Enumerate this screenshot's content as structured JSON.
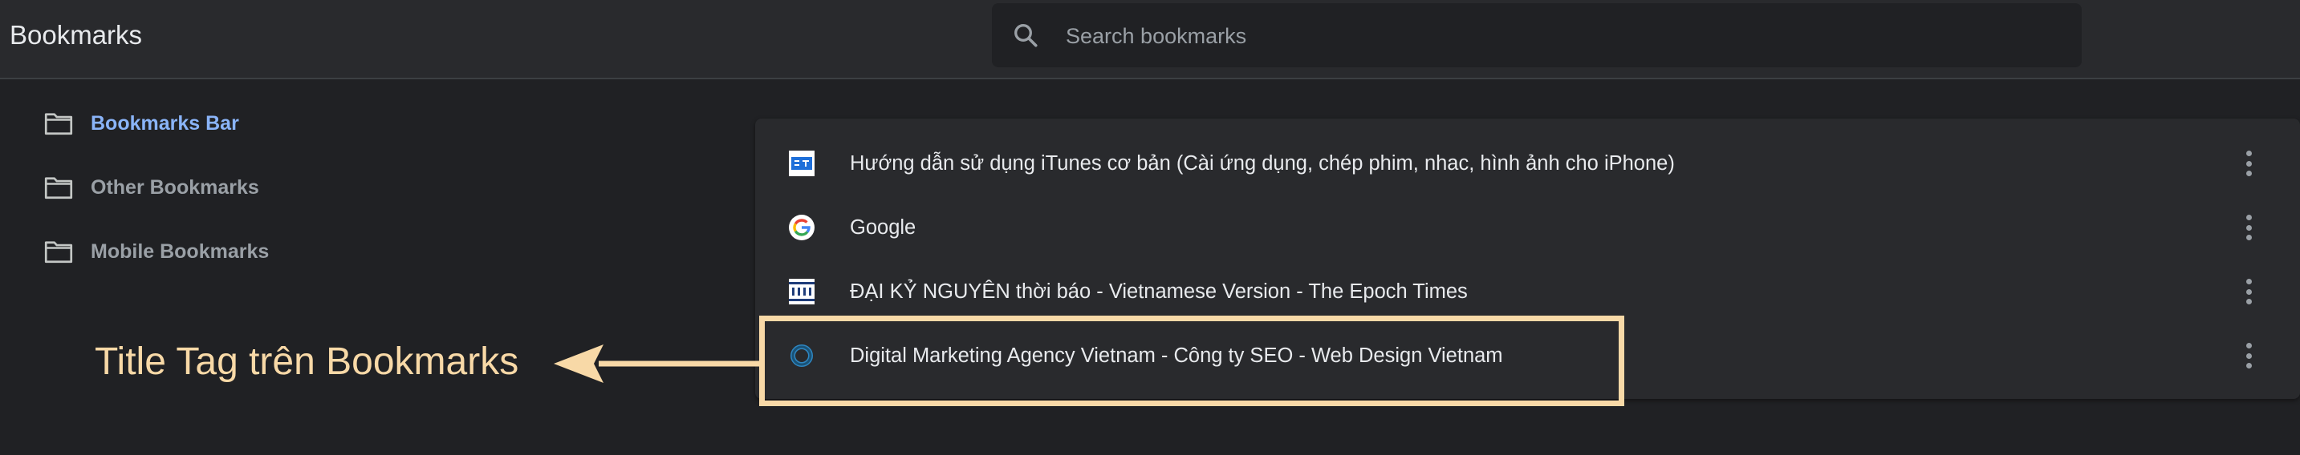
{
  "header": {
    "title": "Bookmarks",
    "search": {
      "placeholder": "Search bookmarks",
      "value": "",
      "icon": "search-icon"
    }
  },
  "sidebar": {
    "items": [
      {
        "label": "Bookmarks Bar",
        "icon": "folder-icon",
        "active": true
      },
      {
        "label": "Other Bookmarks",
        "icon": "folder-icon",
        "active": false
      },
      {
        "label": "Mobile Bookmarks",
        "icon": "folder-icon",
        "active": false
      }
    ]
  },
  "bookmarks": [
    {
      "title": "Hướng dẫn sử dụng iTunes cơ bản (Cài ứng dụng, chép phim, nhac, hình ảnh cho iPhone)",
      "favicon": "bt-favicon-icon",
      "menu_icon": "more-vert-icon"
    },
    {
      "title": "Google",
      "favicon": "google-favicon-icon",
      "menu_icon": "more-vert-icon"
    },
    {
      "title": "ĐẠI KỶ NGUYÊN thời báo - Vietnamese Version - The Epoch Times",
      "favicon": "dkn-favicon-icon",
      "menu_icon": "more-vert-icon"
    },
    {
      "title": "Digital Marketing Agency Vietnam - Công ty SEO - Web Design Vietnam",
      "favicon": "ring-favicon-icon",
      "menu_icon": "more-vert-icon"
    }
  ],
  "annotation": {
    "text": "Title Tag trên Bookmarks",
    "color": "#f8d9a7"
  },
  "colors": {
    "background": "#202124",
    "surface": "#292a2d",
    "accent": "#8ab4f8",
    "text": "#e8eaed",
    "muted": "#9aa0a6"
  }
}
